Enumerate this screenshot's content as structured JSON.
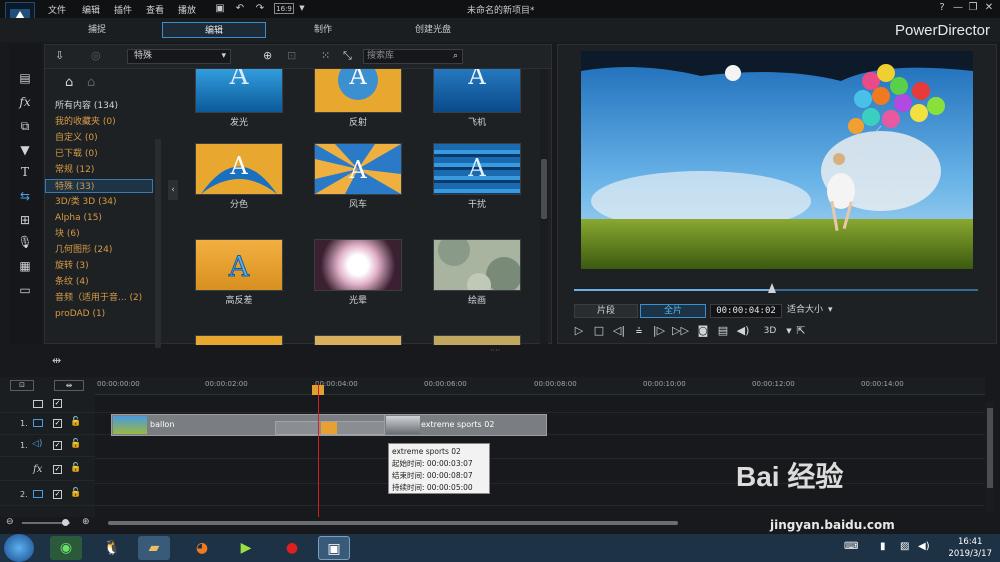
{
  "menu": [
    "文件",
    "编辑",
    "插件",
    "查看",
    "播放"
  ],
  "toolbar": {
    "timecode_icon": "16:9"
  },
  "doc_title": "未命名的新项目*",
  "tabs": [
    "捕捉",
    "编辑",
    "制作",
    "创建光盘"
  ],
  "brand": "PowerDirector",
  "library": {
    "category_selected": "特殊",
    "search_placeholder": "搜索库",
    "categories": [
      {
        "label": "所有内容 (134)"
      },
      {
        "label": "我的收藏夹 (0)"
      },
      {
        "label": "自定义 (0)"
      },
      {
        "label": "已下载 (0)"
      },
      {
        "label": "常规 (12)"
      },
      {
        "label": "特殊 (33)"
      },
      {
        "label": "3D/类 3D (34)"
      },
      {
        "label": "Alpha (15)"
      },
      {
        "label": "块 (6)"
      },
      {
        "label": "几何图形 (24)"
      },
      {
        "label": "旋转 (3)"
      },
      {
        "label": "条纹 (4)"
      },
      {
        "label": "音频（适用于音... (2)"
      },
      {
        "label": "proDAD (1)"
      }
    ],
    "items": [
      {
        "label": "发光"
      },
      {
        "label": "反射"
      },
      {
        "label": "飞机"
      },
      {
        "label": "分色"
      },
      {
        "label": "风车"
      },
      {
        "label": "干扰"
      },
      {
        "label": "高反差"
      },
      {
        "label": "光晕"
      },
      {
        "label": "绘画"
      }
    ]
  },
  "preview": {
    "mode_clip": "片段",
    "mode_full": "全片",
    "timecode": "00:00:04:02",
    "fit": "适合大小",
    "three_d": "3D"
  },
  "timeline": {
    "ticks": [
      "00:00:00:00",
      "00:00:02:00",
      "00:00:04:00",
      "00:00:06:00",
      "00:00:08:00",
      "00:00:10:00",
      "00:00:12:00",
      "00:00:14:00"
    ],
    "track_labels": [
      "1.",
      "1.",
      "2."
    ],
    "clips": [
      {
        "name": "ballon"
      },
      {
        "name": "extreme sports 02"
      }
    ],
    "tooltip": {
      "title": "extreme sports 02",
      "start": "起始时间: 00:00:03:07",
      "end": "结束时间: 00:00:08:07",
      "duration": "持续时间: 00:00:05:00"
    }
  },
  "taskbar": {
    "time": "16:41",
    "date": "2019/3/17"
  },
  "watermark": {
    "main": "Bai 经验",
    "url": "jingyan.baidu.com"
  }
}
